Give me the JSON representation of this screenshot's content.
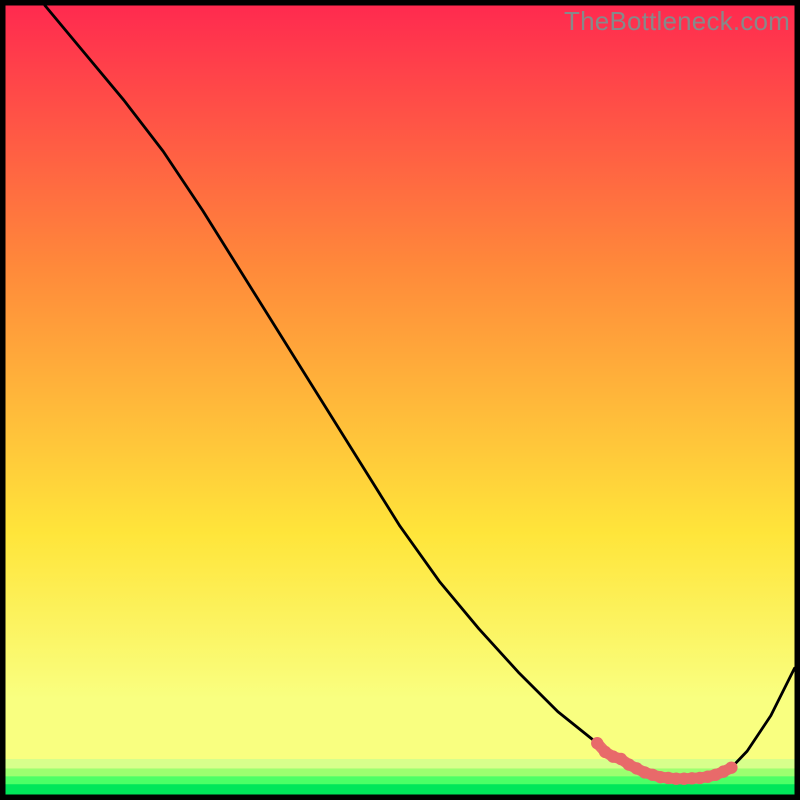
{
  "watermark": "TheBottleneck.com",
  "chart_data": {
    "type": "line",
    "title": "",
    "xlabel": "",
    "ylabel": "",
    "xlim": [
      0,
      100
    ],
    "ylim": [
      0,
      100
    ],
    "series": [
      {
        "name": "curve",
        "x": [
          5,
          10,
          15,
          20,
          25,
          30,
          35,
          40,
          45,
          50,
          55,
          60,
          65,
          70,
          75,
          78,
          80,
          82,
          84,
          86,
          88,
          90,
          92,
          94,
          97,
          100
        ],
        "y": [
          100,
          94,
          88,
          81.5,
          74,
          66,
          58,
          50,
          42,
          34,
          27,
          21,
          15.5,
          10.5,
          6.5,
          4.5,
          3.3,
          2.5,
          2.1,
          2.0,
          2.1,
          2.5,
          3.4,
          5.5,
          10,
          16
        ]
      }
    ],
    "highlight": {
      "name": "optimal-band",
      "x": [
        75,
        76,
        77,
        78,
        79,
        80,
        81,
        82,
        83,
        84,
        85,
        86,
        87,
        88,
        89,
        90,
        91,
        92
      ],
      "y": [
        6.5,
        5.4,
        4.8,
        4.5,
        3.8,
        3.3,
        2.8,
        2.5,
        2.2,
        2.1,
        2.0,
        2.0,
        2.05,
        2.1,
        2.25,
        2.5,
        2.9,
        3.4
      ]
    },
    "colors": {
      "top": "#ff2a4f",
      "mid_upper": "#ff8a3a",
      "mid": "#ffe53a",
      "lower": "#f9ff80",
      "band1": "#d7ff8c",
      "band2": "#9cff70",
      "band3": "#4cff66",
      "band4": "#00e65a",
      "curve": "#000000",
      "highlight": "#e86a6a",
      "border": "#000000"
    }
  }
}
